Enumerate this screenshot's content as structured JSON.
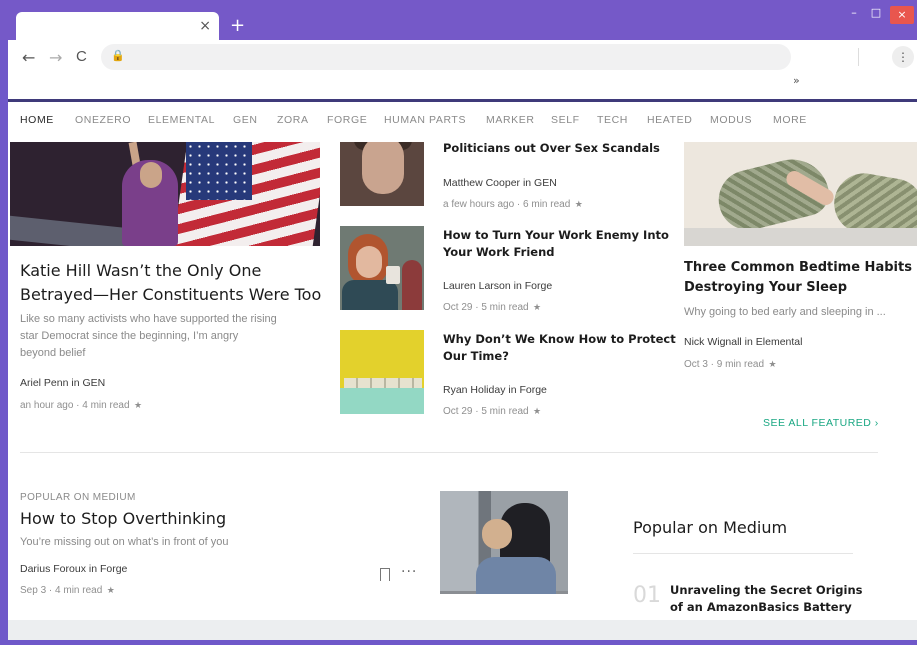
{
  "browser": {
    "tab_close_glyph": "×",
    "new_tab_glyph": "+",
    "window_controls": {
      "minimize": "–",
      "maximize": "□",
      "close": "×"
    },
    "nav": {
      "back": "←",
      "forward": "→",
      "reload": "C"
    },
    "omnibox": {
      "lock_glyph": "🔒",
      "url": ""
    },
    "menu_glyph": "⋮",
    "bookmarks_overflow": "»"
  },
  "topnav": {
    "items": [
      "HOME",
      "ONEZERO",
      "ELEMENTAL",
      "GEN",
      "ZORA",
      "FORGE",
      "HUMAN PARTS",
      "MARKER",
      "SELF",
      "TECH",
      "HEATED",
      "MODUS",
      "MORE"
    ],
    "active": "HOME"
  },
  "featured": {
    "lead": {
      "title_line1": "Katie Hill Wasn’t the Only One",
      "title_line2": "Betrayed—Her Constituents Were Too",
      "excerpt_line1": "Like so many activists who have supported the rising",
      "excerpt_line2": "star Democrat since the beginning, I’m angry",
      "excerpt_line3": "beyond belief",
      "author": "Ariel Penn in GEN",
      "meta": "an hour ago · 4 min read",
      "star": "★"
    },
    "middle": [
      {
        "title_line1": "Politicians out Over Sex Scandals",
        "author": "Matthew Cooper in GEN",
        "meta": "a few hours ago · 6 min read",
        "star": "★"
      },
      {
        "title_line1": "How to Turn Your Work Enemy Into",
        "title_line2": "Your Work Friend",
        "author": "Lauren Larson in Forge",
        "meta": "Oct 29 · 5 min read",
        "star": "★"
      },
      {
        "title_line1": "Why Don’t We Know How to Protect",
        "title_line2": "Our Time?",
        "author": "Ryan Holiday in Forge",
        "meta": "Oct 29 · 5 min read",
        "star": "★"
      }
    ],
    "right": {
      "title_line1": "Three Common Bedtime Habits",
      "title_line2": "Destroying Your Sleep",
      "excerpt": "Why going to bed early and sleeping in ...",
      "author": "Nick Wignall in Elemental",
      "meta": "Oct 3 · 9 min read",
      "star": "★"
    },
    "see_all": "SEE ALL FEATURED ›"
  },
  "popular_story": {
    "kicker": "POPULAR ON MEDIUM",
    "title": "How to Stop Overthinking",
    "excerpt": "You’re missing out on what’s in front of you",
    "author": "Darius Foroux in Forge",
    "meta": "Sep 3 · 4 min read",
    "star": "★",
    "more_glyph": "···"
  },
  "popular_sidebar": {
    "heading": "Popular on Medium",
    "items": [
      {
        "number": "01",
        "title_line1": "Unraveling the Secret Origins",
        "title_line2": "of an AmazonBasics Battery"
      }
    ]
  },
  "colors": {
    "frame": "#7559c8",
    "accent_green": "#1aa783",
    "close_red": "#e9564e"
  }
}
